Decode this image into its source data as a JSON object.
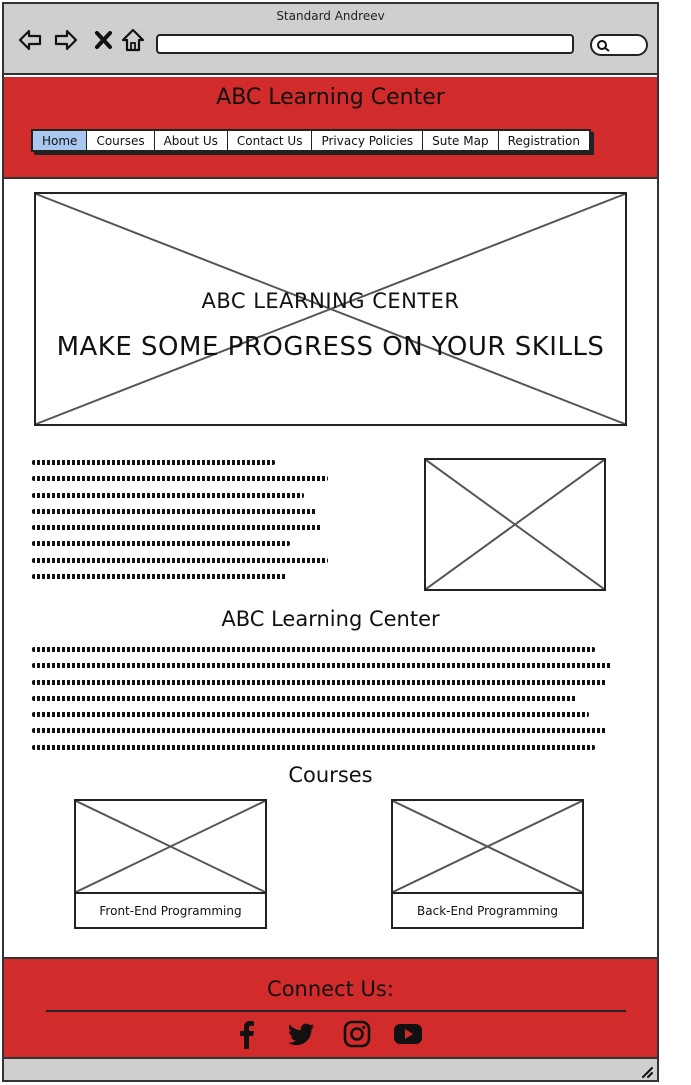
{
  "window": {
    "title": "Standard Andreev"
  },
  "browser": {
    "back_icon": "arrow-left-icon",
    "forward_icon": "arrow-right-icon",
    "close_icon": "x-icon",
    "home_icon": "home-icon",
    "search_icon": "search-icon",
    "address_value": ""
  },
  "header": {
    "title": "ABC Learning Center",
    "menu": [
      {
        "label": "Home",
        "active": true
      },
      {
        "label": "Courses"
      },
      {
        "label": "About Us"
      },
      {
        "label": "Contact Us"
      },
      {
        "label": "Privacy Policies"
      },
      {
        "label": "Sute Map"
      },
      {
        "label": "Registration"
      }
    ]
  },
  "hero": {
    "subtitle": "ABC LEARNING CENTER",
    "headline": "MAKE SOME PROGRESS ON YOUR SKILLS"
  },
  "about": {
    "title": "ABC Learning Center"
  },
  "courses": {
    "title": "Courses",
    "items": [
      {
        "label": "Front-End Programming"
      },
      {
        "label": "Back-End Programming"
      }
    ]
  },
  "footer": {
    "connect_label": "Connect Us:",
    "social": [
      "facebook-icon",
      "twitter-icon",
      "instagram-icon",
      "youtube-icon"
    ]
  },
  "colors": {
    "chrome": "#cfcfcf",
    "brand_red": "#d22b2b",
    "active_tab": "#a8c8f0"
  }
}
